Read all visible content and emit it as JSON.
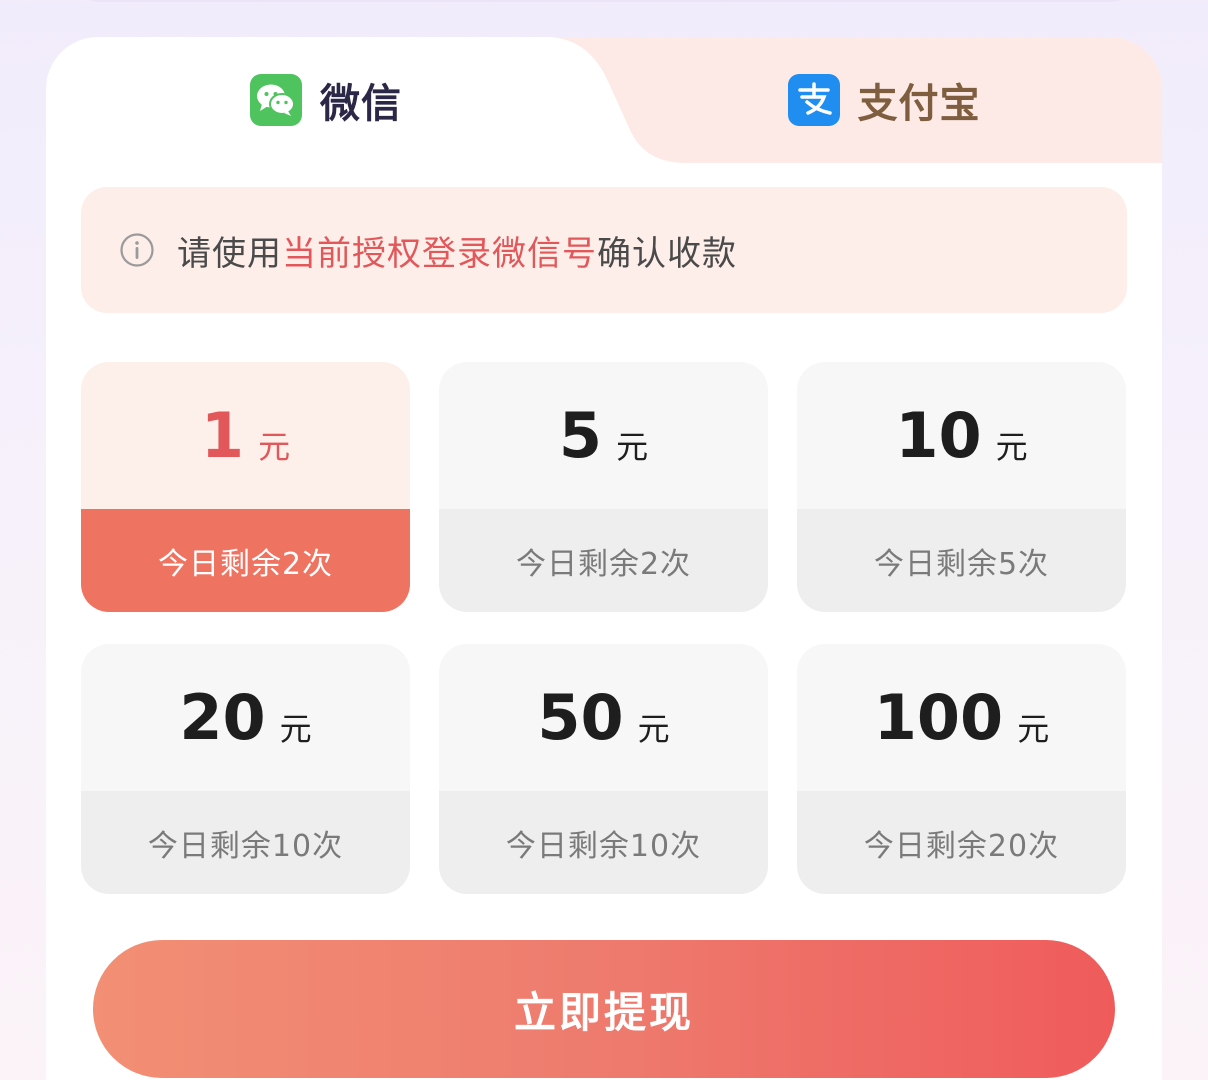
{
  "tabs": {
    "wechat": {
      "label": "微信",
      "icon": "wechat-icon",
      "active": true
    },
    "alipay": {
      "label": "支付宝",
      "icon": "alipay-icon",
      "active": false
    }
  },
  "notice": {
    "icon": "info-icon",
    "prefix": "请使用",
    "highlight": "当前授权登录微信号",
    "suffix": "确认收款"
  },
  "options": [
    {
      "amount": "1",
      "unit": "元",
      "remaining": "今日剩余2次",
      "selected": true
    },
    {
      "amount": "5",
      "unit": "元",
      "remaining": "今日剩余2次",
      "selected": false
    },
    {
      "amount": "10",
      "unit": "元",
      "remaining": "今日剩余5次",
      "selected": false
    },
    {
      "amount": "20",
      "unit": "元",
      "remaining": "今日剩余10次",
      "selected": false
    },
    {
      "amount": "50",
      "unit": "元",
      "remaining": "今日剩余10次",
      "selected": false
    },
    {
      "amount": "100",
      "unit": "元",
      "remaining": "今日剩余20次",
      "selected": false
    }
  ],
  "withdraw_button": {
    "label": "立即提现"
  },
  "colors": {
    "accent_red": "#e2585a",
    "selected_bottom": "#ef7361",
    "wechat_green": "#4fc35e",
    "alipay_blue": "#1f8ef0"
  }
}
